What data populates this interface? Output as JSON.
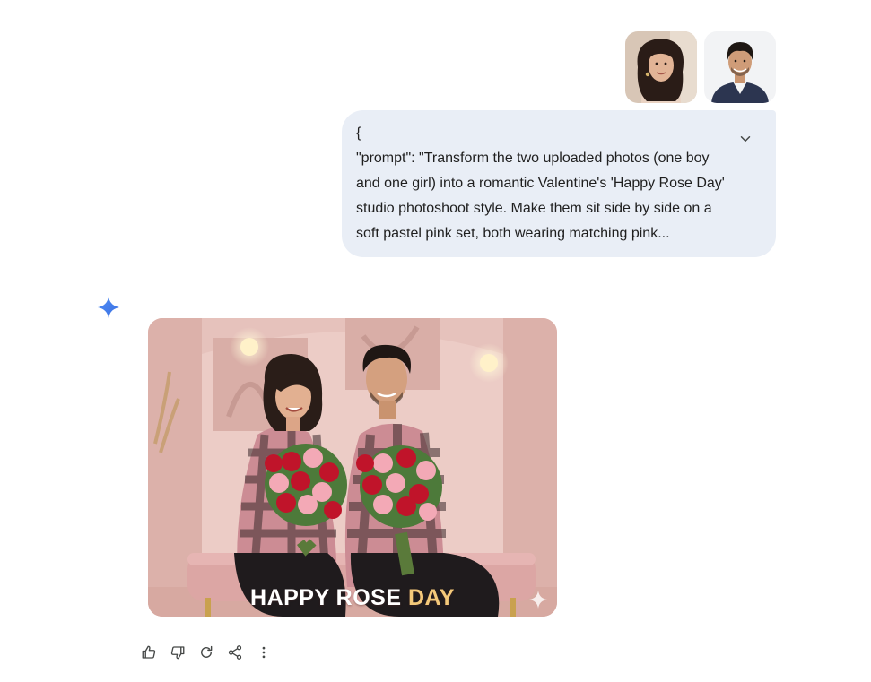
{
  "uploads": [
    {
      "icon": "uploaded-photo-girl"
    },
    {
      "icon": "uploaded-photo-boy"
    }
  ],
  "prompt_bubble": {
    "text": "{\n\"prompt\": \"Transform the two uploaded photos (one boy and one girl) into a romantic Valentine's 'Happy Rose Day' studio photoshoot style. Make them sit side by side on a soft pastel pink set, both wearing matching pink...",
    "expand_icon": "chevron-down-icon"
  },
  "response": {
    "assistant_icon": "gemini-spark-icon",
    "image": {
      "caption_word1": "HAPPY",
      "caption_word2": "ROSE",
      "caption_word3": "DAY",
      "watermark_icon": "sparkle-icon"
    },
    "actions": [
      {
        "name": "thumbs-up-icon"
      },
      {
        "name": "thumbs-down-icon"
      },
      {
        "name": "regenerate-icon"
      },
      {
        "name": "share-icon"
      },
      {
        "name": "more-options-icon"
      }
    ]
  },
  "colors": {
    "bubble_bg": "#e9eef6",
    "accent_blue": "#4285f4",
    "set_pink": "#e8c4bf",
    "rose_red": "#c0142a",
    "rose_pink": "#f3a9b6",
    "caption_gold": "#f4c97a"
  }
}
